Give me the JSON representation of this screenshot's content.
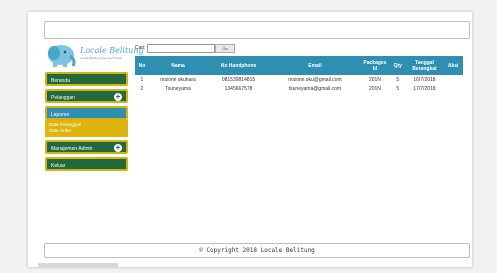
{
  "brand": {
    "name": "Locale Belitung",
    "tagline": "Locale Belitung Tour and Travel"
  },
  "sidebar": {
    "items": [
      {
        "label": "Beranda"
      },
      {
        "label": "Pelanggan"
      },
      {
        "label": "Laporan"
      },
      {
        "label": "Manajemen Admin"
      },
      {
        "label": "Keluar"
      }
    ],
    "submenu": [
      "Data Pelanggan",
      "Data Order"
    ]
  },
  "search": {
    "label": "Cari:",
    "value": "",
    "button": "Go"
  },
  "table": {
    "headers": [
      "No",
      "Nama",
      "No Handphone",
      "Email",
      "Packages Id",
      "Qty",
      "Tanggal Berangkat",
      "Aksi"
    ],
    "rows": [
      [
        "1",
        "nozomi okuhara",
        "081539814815",
        "nozomi.oku@gmail.com",
        "201N",
        "5",
        "16/7/2018",
        ""
      ],
      [
        "2",
        "Tsuneyama",
        "1345667578",
        "tsuneyama@gmail.com",
        "201N",
        "5",
        "17/7/2018",
        ""
      ]
    ]
  },
  "footer": {
    "text": "© Copyright 2018 Locale Belitung"
  },
  "colors": {
    "menu_green": "#206a3d",
    "menu_border": "#d9b00e",
    "header_blue": "#2e8fb3",
    "submenu_gold": "#e0b40e"
  }
}
